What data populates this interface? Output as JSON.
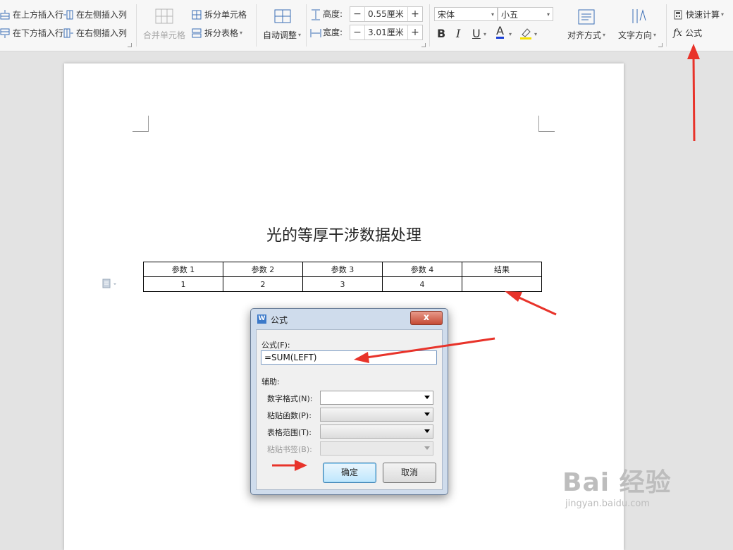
{
  "ribbon": {
    "insert_above_row": "在上方插入行",
    "insert_below_row": "在下方插入行",
    "insert_left_col": "在左侧插入列",
    "insert_right_col": "在右侧插入列",
    "merge_cells": "合并单元格",
    "split_cells": "拆分单元格",
    "split_table": "拆分表格",
    "auto_fit": "自动调整",
    "height_label": "高度:",
    "height_value": "0.55厘米",
    "width_label": "宽度:",
    "width_value": "3.01厘米",
    "font_name": "宋体",
    "font_size": "小五",
    "align": "对齐方式",
    "text_direction": "文字方向",
    "quick_calc": "快速计算",
    "formula": "公式",
    "fx": "fx",
    "minus": "−",
    "plus": "+",
    "bold": "B",
    "italic": "I",
    "underline": "U",
    "font_color": "A"
  },
  "document": {
    "title": "光的等厚干涉数据处理",
    "headers": [
      "参数 1",
      "参数 2",
      "参数 3",
      "参数 4",
      "结果"
    ],
    "rows": [
      [
        "1",
        "2",
        "3",
        "4",
        ""
      ]
    ]
  },
  "dialog": {
    "title": "公式",
    "close": "x",
    "icon_letter": "W",
    "formula_label": "公式(F):",
    "formula_value": "=SUM(LEFT)",
    "assist_label": "辅助:",
    "number_format_label": "数字格式(N):",
    "paste_function_label": "粘贴函数(P):",
    "table_range_label": "表格范围(T):",
    "paste_bookmark_label": "粘贴书签(B):",
    "ok": "确定",
    "cancel": "取消"
  },
  "watermark": {
    "brand": "Bai 经验",
    "url": "jingyan.baidu.com"
  },
  "colors": {
    "annotation_arrow": "#e8332a",
    "font_color_bar": "#1a3fd6",
    "highlight_bar": "#f5e100"
  }
}
